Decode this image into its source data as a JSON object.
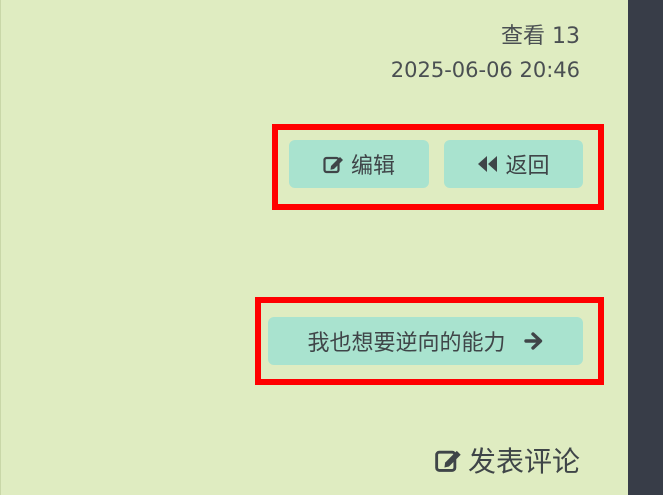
{
  "meta": {
    "views": "查看 13",
    "date": "2025-06-06 20:46"
  },
  "actions": {
    "edit_label": "编辑",
    "edit_icon": "edit-icon",
    "back_label": "返回",
    "back_icon": "backward-icon"
  },
  "next_post": {
    "label": "我也想要逆向的能力",
    "icon": "arrow-right-icon"
  },
  "comment": {
    "label": "发表评论",
    "icon": "edit-icon"
  },
  "colors": {
    "background": "#dfecc1",
    "button": "#a9e3cf",
    "sidebar": "#383d48",
    "highlight": "#ff0000"
  }
}
